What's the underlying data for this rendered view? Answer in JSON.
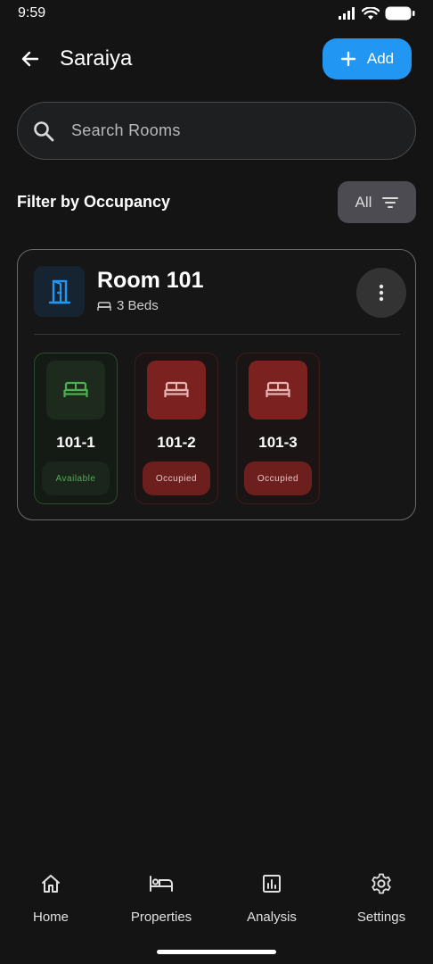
{
  "status_bar": {
    "time": "9:59"
  },
  "header": {
    "title": "Saraiya",
    "add_label": "Add"
  },
  "search": {
    "placeholder": "Search Rooms"
  },
  "filter": {
    "label": "Filter by Occupancy",
    "value": "All"
  },
  "room": {
    "name": "Room 101",
    "beds_text": "3 Beds",
    "beds": [
      {
        "label": "101-1",
        "status": "Available"
      },
      {
        "label": "101-2",
        "status": "Occupied"
      },
      {
        "label": "101-3",
        "status": "Occupied"
      }
    ]
  },
  "nav": {
    "items": [
      {
        "label": "Home"
      },
      {
        "label": "Properties"
      },
      {
        "label": "Analysis"
      },
      {
        "label": "Settings"
      }
    ]
  },
  "colors": {
    "accent": "#2196f3",
    "available": "#4caf50",
    "occupied": "#7b2220",
    "background": "#141414"
  }
}
